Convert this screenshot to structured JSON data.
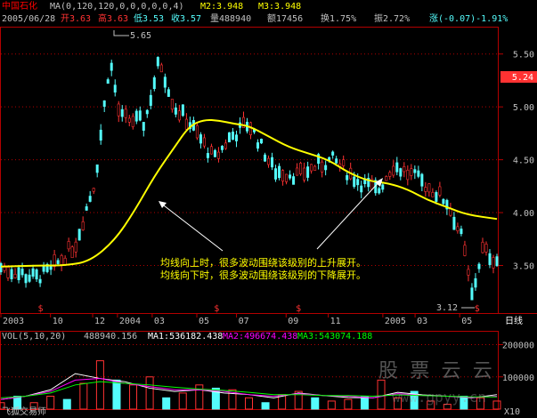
{
  "header": {
    "stock_name": "中国石化",
    "ma_params": "MA(0,120,120,0,0,0,0,0,4)",
    "ma2": "M2:3.948",
    "ma3": "M3:3.948",
    "date": "2005/06/28",
    "open": "开3.63",
    "high": "高3.63",
    "low": "低3.53",
    "close": "收3.57",
    "volume": "量488940",
    "amount": "额17456",
    "turnover": "换1.75%",
    "amplitude": "振2.72%",
    "change": "涨(-0.07)-1.91%"
  },
  "price_tag": "5.24",
  "annotation": {
    "high_label": "5.65",
    "low_label": "3.12",
    "line1": "均线向上时，很多波动围绕该级别的上升展开。",
    "line2": "均线向下时，很多波动围绕该级别的下降展开。"
  },
  "footer": {
    "app_label": "飞狐交易师",
    "scale_label": "X10",
    "period_label": "日线"
  },
  "watermark": "股 票 云 云",
  "watermark_url": "www.gpyy.cn",
  "volume_header": {
    "label": "VOL(5,10,20)",
    "value": "488940.156",
    "ma1": "MA1:536182.438",
    "ma2": "MA2:496674.438",
    "ma3": "MA3:543074.188"
  },
  "colors": {
    "up": "#ff3232",
    "down": "#54fcfc",
    "ma": "#ffff00",
    "grid": "#b40000",
    "text": "#c0c0c0",
    "ma1": "#ffffff",
    "ma2": "#ff00ff",
    "ma3": "#00ff00"
  },
  "chart_data": [
    {
      "type": "candlestick",
      "title": "中国石化",
      "x_ticks": [
        "2003",
        "10",
        "12",
        "2004",
        "03",
        "05",
        "07",
        "09",
        "11",
        "2005",
        "03",
        "05"
      ],
      "y_ticks": [
        3.5,
        4.0,
        4.5,
        5.0,
        5.5
      ],
      "ylim": [
        3.05,
        5.75
      ],
      "series": [
        {
          "name": "M2",
          "x": [
            0,
            0.08,
            0.13,
            0.18,
            0.23,
            0.27,
            0.31,
            0.35,
            0.38,
            0.41,
            0.44,
            0.47,
            0.5,
            0.54,
            0.58,
            0.62,
            0.66,
            0.7,
            0.74,
            0.78,
            0.82,
            0.86,
            0.9,
            0.94,
            1.0
          ],
          "values": [
            3.49,
            3.5,
            3.5,
            3.54,
            3.74,
            4.02,
            4.35,
            4.62,
            4.82,
            4.88,
            4.87,
            4.84,
            4.82,
            4.72,
            4.62,
            4.56,
            4.5,
            4.38,
            4.3,
            4.28,
            4.22,
            4.12,
            4.05,
            3.98,
            3.94
          ]
        }
      ]
    },
    {
      "type": "bar",
      "title": "VOL(5,10,20)",
      "y_ticks": [
        100000,
        200000
      ],
      "ylim": [
        0,
        240000
      ],
      "values": [
        20000,
        40000,
        20000,
        40000,
        30000,
        80000,
        150000,
        90000,
        75000,
        100000,
        35000,
        50000,
        75000,
        65000,
        60000,
        35000,
        20000,
        45000,
        55000,
        35000,
        25000,
        30000,
        40000,
        90000,
        35000,
        55000,
        25000,
        15000,
        40000,
        35000,
        25000
      ],
      "series": [
        {
          "name": "MA1",
          "values": [
            30000,
            40000,
            60000,
            110000,
            95000,
            85000,
            65000,
            55000,
            60000,
            50000,
            45000,
            35000,
            50000,
            42000,
            36000,
            35000,
            52000,
            44000,
            40000,
            35000,
            45000
          ]
        },
        {
          "name": "MA2",
          "values": [
            30000,
            40000,
            55000,
            90000,
            95000,
            80000,
            70000,
            60000,
            60000,
            55000,
            45000,
            40000,
            48000,
            42000,
            40000,
            35000,
            48000,
            42000,
            40000,
            36000,
            40000
          ]
        },
        {
          "name": "MA3",
          "values": [
            35000,
            40000,
            50000,
            75000,
            85000,
            80000,
            75000,
            68000,
            62000,
            58000,
            52000,
            45000,
            45000,
            42000,
            42000,
            40000,
            44000,
            42000,
            40000,
            38000,
            38000
          ]
        }
      ]
    }
  ]
}
